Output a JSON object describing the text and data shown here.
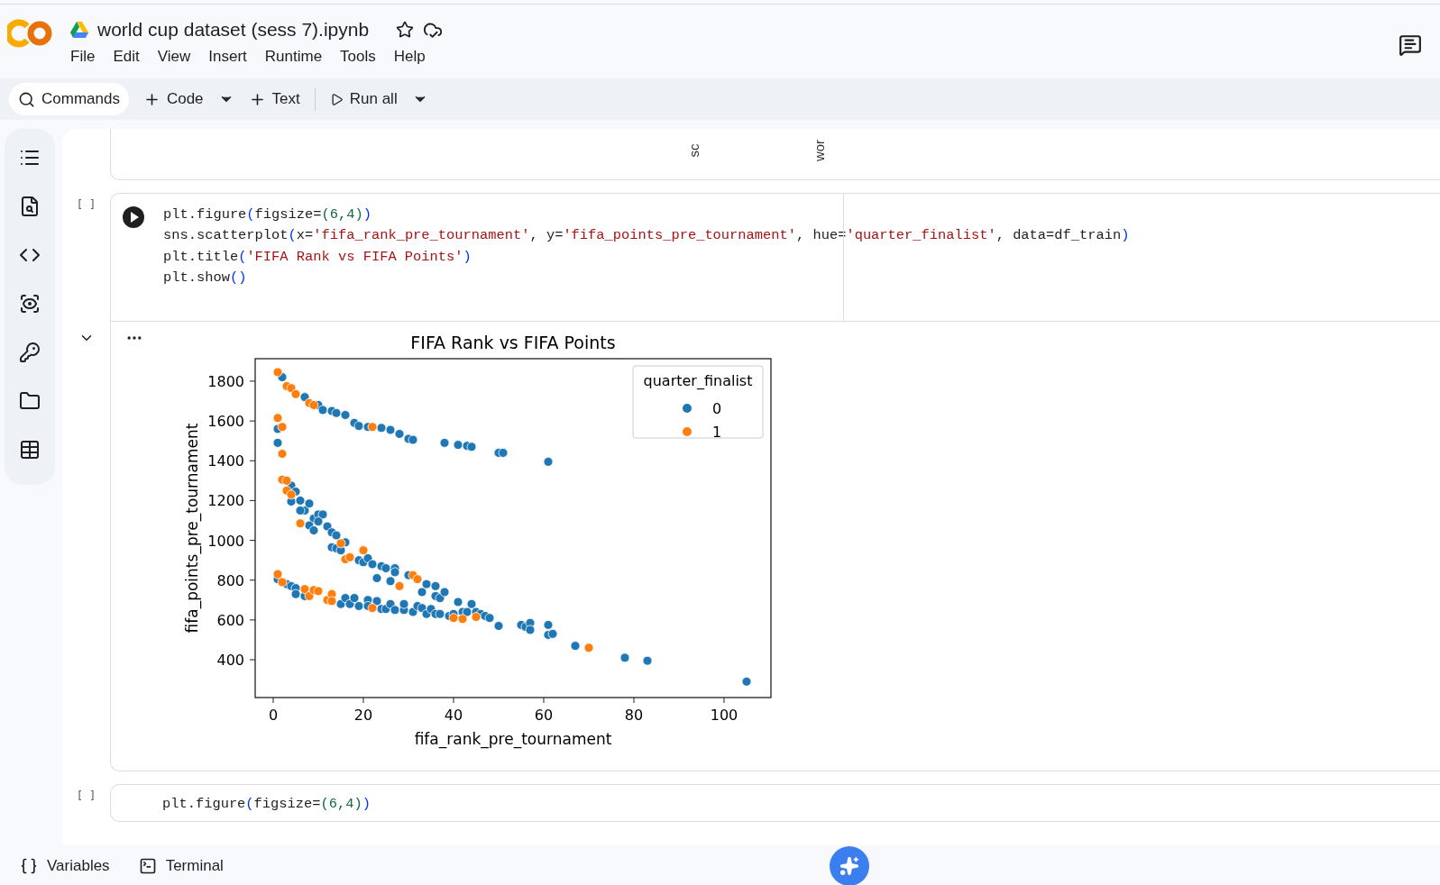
{
  "notebook_title": "world cup dataset (sess 7).ipynb",
  "menu": [
    "File",
    "Edit",
    "View",
    "Insert",
    "Runtime",
    "Tools",
    "Help"
  ],
  "toolbar": [
    {
      "label": "Commands",
      "kind": "search",
      "dropdown": false
    },
    {
      "label": "Code",
      "kind": "add",
      "dropdown": true
    },
    {
      "label": "Text",
      "kind": "add",
      "dropdown": false
    },
    {
      "label": "Run all",
      "kind": "run",
      "dropdown": true
    }
  ],
  "previous_output": {
    "column_headers": [
      "sc",
      "wor"
    ]
  },
  "code_cell": {
    "exec_count": "[ ]",
    "lines": [
      [
        {
          "text": "plt.figure",
          "kind": "plain"
        },
        {
          "text": "(",
          "kind": "bracket"
        },
        {
          "text": "figsize=",
          "kind": "plain"
        },
        {
          "text": "(6,4)",
          "kind": "number"
        },
        {
          "text": ")",
          "kind": "bracket"
        }
      ],
      [
        {
          "text": "sns.scatterplot",
          "kind": "plain"
        },
        {
          "text": "(",
          "kind": "bracket"
        },
        {
          "text": "x=",
          "kind": "plain"
        },
        {
          "text": "'fifa_rank_pre_tournament'",
          "kind": "string"
        },
        {
          "text": ", y=",
          "kind": "plain"
        },
        {
          "text": "'fifa_points_pre_tournament'",
          "kind": "string"
        },
        {
          "text": ", hue=",
          "kind": "plain"
        },
        {
          "text": "'quarter_finalist'",
          "kind": "string"
        },
        {
          "text": ", data=df_train",
          "kind": "plain"
        },
        {
          "text": ")",
          "kind": "bracket"
        }
      ],
      [
        {
          "text": "plt.title",
          "kind": "plain"
        },
        {
          "text": "(",
          "kind": "bracket"
        },
        {
          "text": "'FIFA Rank vs FIFA Points'",
          "kind": "string"
        },
        {
          "text": ")",
          "kind": "bracket"
        }
      ],
      [
        {
          "text": "plt.show",
          "kind": "plain"
        },
        {
          "text": "()",
          "kind": "bracket"
        }
      ]
    ]
  },
  "output": {
    "expanded": true,
    "chart_data": {
      "type": "scatter",
      "title": "FIFA Rank vs FIFA Points",
      "xlabel": "fifa_rank_pre_tournament",
      "ylabel": "fifa_points_pre_tournament",
      "xlim": [
        -4,
        110.4
      ],
      "ylim": [
        210,
        1913
      ],
      "xticks": [
        {
          "value": 0,
          "label": "0"
        },
        {
          "value": 20,
          "label": "20"
        },
        {
          "value": 40,
          "label": "40"
        },
        {
          "value": 60,
          "label": "60"
        },
        {
          "value": 80,
          "label": "80"
        },
        {
          "value": 100,
          "label": "100"
        }
      ],
      "yticks": [
        {
          "value": 400,
          "label": "400"
        },
        {
          "value": 600,
          "label": "600"
        },
        {
          "value": 800,
          "label": "800"
        },
        {
          "value": 1000,
          "label": "1000"
        },
        {
          "value": 1200,
          "label": "1200"
        },
        {
          "value": 1400,
          "label": "1400"
        },
        {
          "value": 1600,
          "label": "1600"
        },
        {
          "value": 1800,
          "label": "1800"
        }
      ],
      "legend": {
        "title": "quarter_finalist"
      },
      "series": [
        {
          "name": "0",
          "color": "#1f77b4",
          "x": [
            2,
            7,
            10,
            11,
            13,
            14,
            16,
            18,
            19,
            21,
            24,
            26,
            28,
            30,
            31,
            38,
            41,
            43,
            44,
            50,
            51,
            61,
            1,
            1,
            4,
            5,
            4,
            6,
            7,
            6,
            8,
            9,
            10,
            11,
            10,
            8,
            9,
            12,
            13,
            14,
            16,
            13,
            14,
            15,
            19,
            20,
            21,
            22,
            24,
            25,
            27,
            27,
            23,
            26,
            30,
            33,
            34,
            36,
            36,
            37,
            38,
            41,
            44,
            42,
            1,
            3,
            4,
            5,
            5,
            7,
            15,
            16,
            17,
            18,
            19,
            21,
            21,
            23,
            24,
            25,
            26,
            27,
            29,
            29,
            31,
            32,
            33,
            34,
            35,
            36,
            37,
            39,
            40,
            43,
            45,
            46,
            47,
            48,
            50,
            55,
            56,
            57,
            57,
            61,
            61,
            62,
            67,
            78,
            83,
            105
          ],
          "values": [
            1820,
            1720,
            1680,
            1655,
            1650,
            1640,
            1630,
            1590,
            1575,
            1570,
            1565,
            1555,
            1535,
            1510,
            1505,
            1490,
            1480,
            1475,
            1470,
            1440,
            1440,
            1395,
            1560,
            1490,
            1275,
            1245,
            1195,
            1200,
            1150,
            1150,
            1185,
            1110,
            1130,
            1130,
            1095,
            1075,
            1050,
            1070,
            1040,
            1025,
            990,
            965,
            960,
            950,
            900,
            890,
            910,
            880,
            870,
            860,
            860,
            840,
            810,
            795,
            825,
            740,
            780,
            770,
            720,
            710,
            740,
            690,
            680,
            640,
            805,
            780,
            770,
            760,
            730,
            720,
            680,
            710,
            680,
            710,
            670,
            700,
            670,
            695,
            655,
            655,
            680,
            650,
            650,
            680,
            640,
            670,
            660,
            630,
            655,
            630,
            630,
            620,
            630,
            640,
            640,
            630,
            620,
            610,
            570,
            575,
            565,
            585,
            550,
            575,
            525,
            530,
            470,
            410,
            395,
            290
          ]
        },
        {
          "name": "1",
          "color": "#ff7f0e",
          "x": [
            1,
            3,
            4,
            5,
            8,
            9,
            22,
            1,
            2,
            2,
            2,
            3,
            4,
            6,
            15,
            16,
            17,
            20,
            28,
            31,
            32,
            3,
            1,
            2,
            7,
            8,
            9,
            10,
            12,
            13,
            13,
            22,
            40,
            42,
            45,
            70
          ],
          "values": [
            1845,
            1775,
            1765,
            1735,
            1690,
            1680,
            1570,
            1615,
            1570,
            1435,
            1305,
            1250,
            1230,
            1085,
            985,
            905,
            915,
            950,
            770,
            825,
            805,
            1300,
            830,
            790,
            755,
            720,
            750,
            745,
            700,
            730,
            695,
            660,
            610,
            605,
            615,
            460
          ]
        }
      ]
    }
  },
  "next_cell": {
    "exec_count": "[ ]",
    "lines": [
      [
        {
          "text": "plt.figure",
          "kind": "plain"
        },
        {
          "text": "(",
          "kind": "bracket"
        },
        {
          "text": "figsize=",
          "kind": "plain"
        },
        {
          "text": "(6,4)",
          "kind": "number"
        },
        {
          "text": ")",
          "kind": "bracket"
        }
      ]
    ]
  },
  "bottom_bar": [
    {
      "label": "Variables",
      "kind": "variables"
    },
    {
      "label": "Terminal",
      "kind": "terminal"
    }
  ]
}
